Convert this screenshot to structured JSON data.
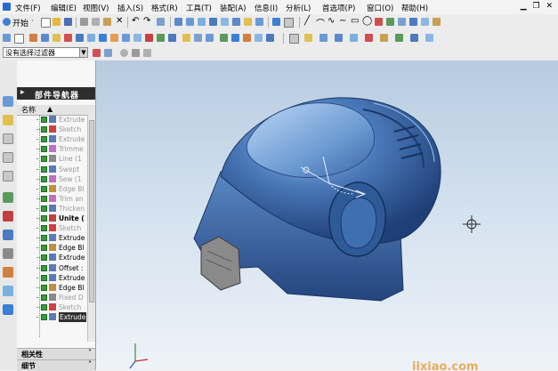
{
  "menu": [
    "文件(F)",
    "编辑(E)",
    "视图(V)",
    "插入(S)",
    "格式(R)",
    "工具(T)",
    "装配(A)",
    "信息(I)",
    "分析(L)",
    "首选项(P)",
    "窗口(O)",
    "帮助(H)"
  ],
  "toolbar": {
    "start_label": "开始",
    "start_suffix": "·"
  },
  "filter": {
    "value": "没有选择过滤器"
  },
  "navigator": {
    "title": "部件导航器",
    "column_header": "名称",
    "items": [
      {
        "label": "Extrude",
        "state": "dim"
      },
      {
        "label": "Sketch",
        "state": "dim"
      },
      {
        "label": "Extrude",
        "state": "dim"
      },
      {
        "label": "Trimme",
        "state": "dim"
      },
      {
        "label": "Line (1",
        "state": "dim"
      },
      {
        "label": "Swept",
        "state": "dim"
      },
      {
        "label": "Sew (1",
        "state": "dim"
      },
      {
        "label": "Edge Bl",
        "state": "dim"
      },
      {
        "label": "Trim an",
        "state": "dim"
      },
      {
        "label": "Thicken",
        "state": "dim"
      },
      {
        "label": "Unite (",
        "state": "bold"
      },
      {
        "label": "Sketch",
        "state": "dim"
      },
      {
        "label": "Extrude",
        "state": "normal"
      },
      {
        "label": "Edge Bl",
        "state": "normal"
      },
      {
        "label": "Extrude",
        "state": "normal"
      },
      {
        "label": "Offset :",
        "state": "normal"
      },
      {
        "label": "Extrude",
        "state": "normal"
      },
      {
        "label": "Edge Bl",
        "state": "normal"
      },
      {
        "label": "Fixed D",
        "state": "dim"
      },
      {
        "label": "Sketch",
        "state": "dim"
      },
      {
        "label": "Extrude",
        "state": "selected"
      }
    ],
    "panels": [
      "相关性",
      "细节"
    ]
  },
  "viewport": {
    "watermark": "jixiao.com"
  },
  "colors": {
    "model": "#4a78b8",
    "nav_header": "#2e2e2e",
    "viewport_top": "#b7cbe0",
    "viewport_bottom": "#eef3f8"
  }
}
